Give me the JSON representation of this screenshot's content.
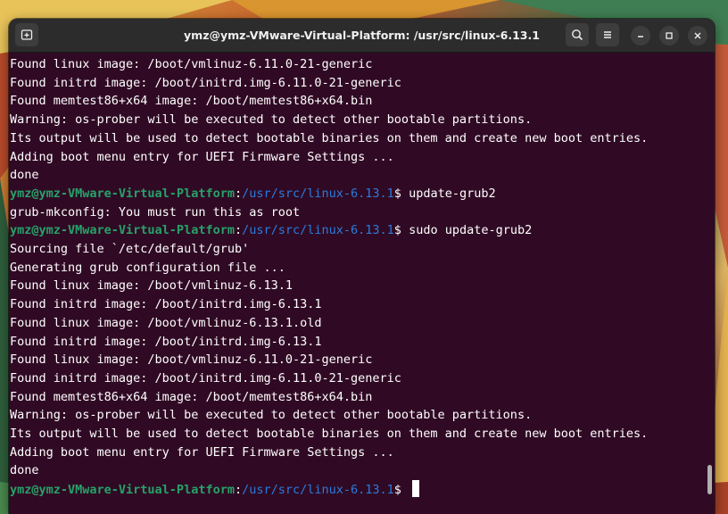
{
  "window": {
    "title": "ymz@ymz-VMware-Virtual-Platform: /usr/src/linux-6.13.1"
  },
  "titlebar_icons": {
    "new_tab": "new-tab-icon",
    "search": "search-icon",
    "menu": "hamburger-menu-icon",
    "minimize": "minimize-icon",
    "maximize": "maximize-icon",
    "close": "close-icon"
  },
  "prompt": {
    "user_host": "ymz@ymz-VMware-Virtual-Platform",
    "colon": ":",
    "path": "/usr/src/linux-6.13.1",
    "symbol": "$"
  },
  "terminal": {
    "lines": [
      {
        "type": "output",
        "text": "Found linux image: /boot/vmlinuz-6.11.0-21-generic"
      },
      {
        "type": "output",
        "text": "Found initrd image: /boot/initrd.img-6.11.0-21-generic"
      },
      {
        "type": "output",
        "text": "Found memtest86+x64 image: /boot/memtest86+x64.bin"
      },
      {
        "type": "output",
        "text": "Warning: os-prober will be executed to detect other bootable partitions."
      },
      {
        "type": "output",
        "text": "Its output will be used to detect bootable binaries on them and create new boot entries."
      },
      {
        "type": "output",
        "text": "Adding boot menu entry for UEFI Firmware Settings ..."
      },
      {
        "type": "output",
        "text": "done"
      },
      {
        "type": "prompt",
        "command": " update-grub2"
      },
      {
        "type": "output",
        "text": "grub-mkconfig: You must run this as root"
      },
      {
        "type": "prompt",
        "command": " sudo update-grub2"
      },
      {
        "type": "output",
        "text": "Sourcing file `/etc/default/grub'"
      },
      {
        "type": "output",
        "text": "Generating grub configuration file ..."
      },
      {
        "type": "output",
        "text": "Found linux image: /boot/vmlinuz-6.13.1"
      },
      {
        "type": "output",
        "text": "Found initrd image: /boot/initrd.img-6.13.1"
      },
      {
        "type": "output",
        "text": "Found linux image: /boot/vmlinuz-6.13.1.old"
      },
      {
        "type": "output",
        "text": "Found initrd image: /boot/initrd.img-6.13.1"
      },
      {
        "type": "output",
        "text": "Found linux image: /boot/vmlinuz-6.11.0-21-generic"
      },
      {
        "type": "output",
        "text": "Found initrd image: /boot/initrd.img-6.11.0-21-generic"
      },
      {
        "type": "output",
        "text": "Found memtest86+x64 image: /boot/memtest86+x64.bin"
      },
      {
        "type": "output",
        "text": "Warning: os-prober will be executed to detect other bootable partitions."
      },
      {
        "type": "output",
        "text": "Its output will be used to detect bootable binaries on them and create new boot entries."
      },
      {
        "type": "output",
        "text": "Adding boot menu entry for UEFI Firmware Settings ..."
      },
      {
        "type": "output",
        "text": "done"
      },
      {
        "type": "prompt",
        "command": " ",
        "cursor": true
      }
    ]
  }
}
